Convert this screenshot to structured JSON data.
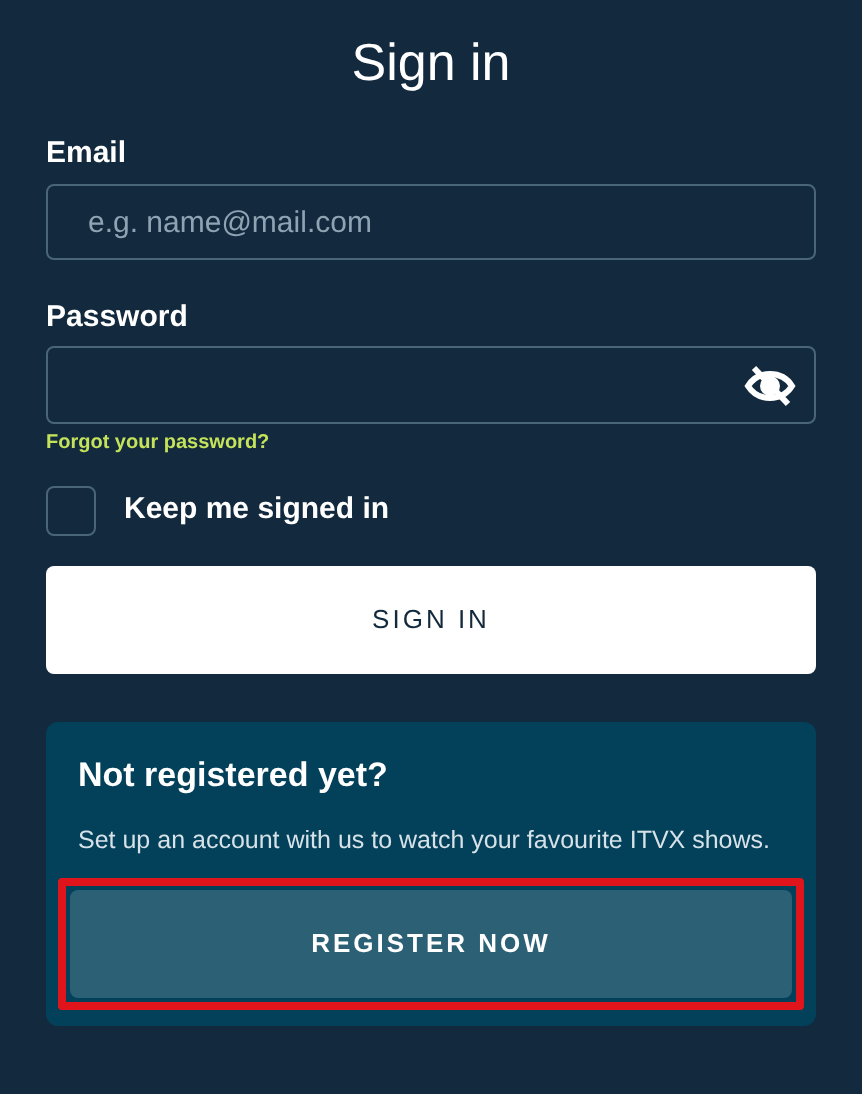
{
  "title": "Sign in",
  "email": {
    "label": "Email",
    "placeholder": "e.g. name@mail.com"
  },
  "password": {
    "label": "Password",
    "forgot_link": "Forgot your password?"
  },
  "keep_signed_in": {
    "label": "Keep me signed in",
    "checked": false
  },
  "sign_in_button": "SIGN IN",
  "register": {
    "heading": "Not registered yet?",
    "text": "Set up an account with us to watch your favourite ITVX shows.",
    "button": "REGISTER NOW",
    "highlighted": true
  }
}
